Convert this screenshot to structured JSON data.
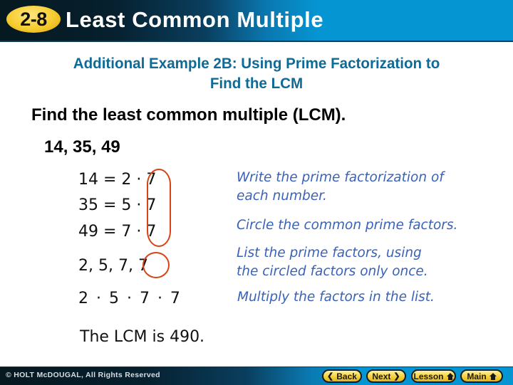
{
  "header": {
    "lesson_number": "2-8",
    "title": "Least Common Multiple"
  },
  "subtitle": {
    "line1": "Additional Example 2B: Using Prime Factorization to",
    "line2": "Find the LCM"
  },
  "prompt": "Find the least common multiple (LCM).",
  "numbers": "14, 35, 49",
  "factorizations": [
    "14 = 2 · 7",
    "35 = 5 · 7",
    "49 = 7 · 7"
  ],
  "factor_list": "2, 5, 7, 7",
  "product": "2 · 5 · 7 · 7",
  "answer": "The LCM is 490.",
  "notes": {
    "step1_line1": "Write the prime factorization of",
    "step1_line2": "each number.",
    "step2": "Circle the common prime factors.",
    "step3_line1": "List the prime factors, using",
    "step3_line2": "the circled factors only once.",
    "step4": "Multiply the factors in the list."
  },
  "colors": {
    "subtitle": "#0e6a96",
    "notes": "#3a62b8",
    "circle": "#d84315",
    "nav_button": "#f8d84a"
  },
  "footer": {
    "copyright": "© HOLT McDOUGAL, All Rights Reserved",
    "nav": {
      "back": "Back",
      "next": "Next",
      "lesson": "Lesson",
      "main": "Main"
    }
  }
}
